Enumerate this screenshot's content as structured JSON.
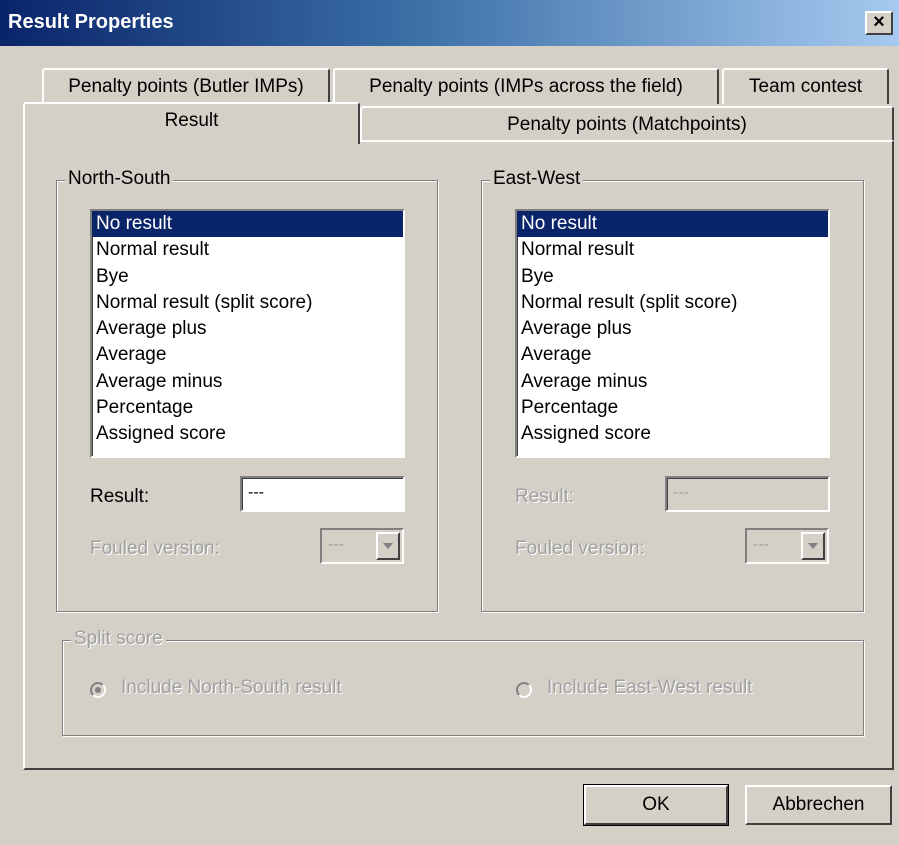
{
  "window": {
    "title": "Result Properties",
    "close_label": "×"
  },
  "tabs": {
    "row1": [
      "Penalty points (Butler IMPs)",
      "Penalty points (IMPs across the field)",
      "Team contest"
    ],
    "row2": [
      "Result",
      "Penalty points (Matchpoints)"
    ],
    "active": "Result"
  },
  "north_south": {
    "title": "North-South",
    "items": [
      "No result",
      "Normal result",
      "Bye",
      "Normal result (split score)",
      "Average plus",
      "Average",
      "Average minus",
      "Percentage",
      "Assigned score"
    ],
    "selected": "No result",
    "result_label": "Result:",
    "result_value": "---",
    "fouled_label": "Fouled version:",
    "fouled_value": "---"
  },
  "east_west": {
    "title": "East-West",
    "items": [
      "No result",
      "Normal result",
      "Bye",
      "Normal result (split score)",
      "Average plus",
      "Average",
      "Average minus",
      "Percentage",
      "Assigned score"
    ],
    "selected": "No result",
    "result_label": "Result:",
    "result_value": "---",
    "fouled_label": "Fouled version:",
    "fouled_value": "---"
  },
  "split_score": {
    "title": "Split score",
    "option_ns": "Include North-South result",
    "option_ew": "Include East-West result",
    "selected": "Include North-South result"
  },
  "buttons": {
    "ok": "OK",
    "cancel": "Abbrechen"
  },
  "colors": {
    "title_start": "#0a246a",
    "title_end": "#a6caf0",
    "selection": "#0a246a",
    "face": "#d4d0c8"
  }
}
